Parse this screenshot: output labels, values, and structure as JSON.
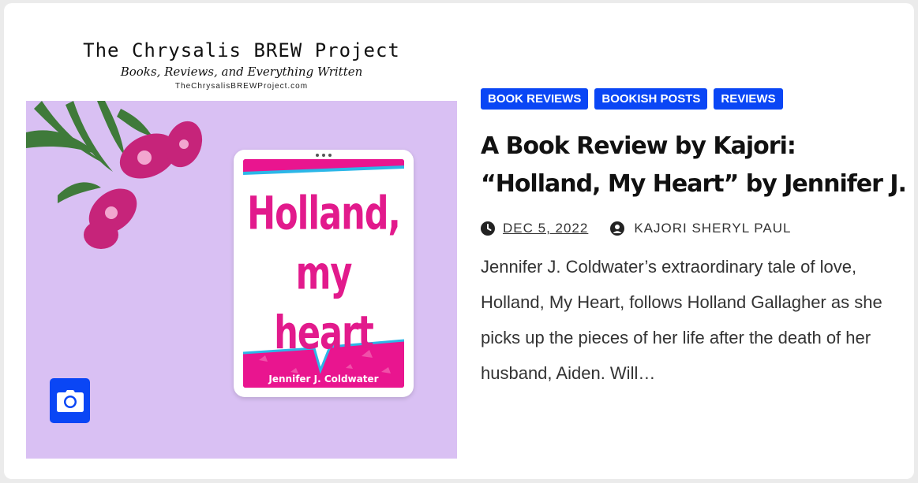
{
  "logo": {
    "title": "The Chrysalis BREW Project",
    "tagline": "Books, Reviews, and Everything Written",
    "url": "TheChrysalisBREWProject.com"
  },
  "cover": {
    "title_line1": "Holland,",
    "title_line2": "my",
    "title_line3": "heart",
    "author": "Jennifer J. Coldwater"
  },
  "categories": [
    "BOOK REVIEWS",
    "BOOKISH POSTS",
    "REVIEWS"
  ],
  "post": {
    "title": "A Book Review by Kajori: “Holland, My Heart” by Jennifer J.",
    "date": "DEC 5, 2022",
    "author": "KAJORI SHERYL PAUL",
    "excerpt": "Jennifer J. Coldwater’s extraordinary tale of love, Holland, My Heart, follows Holland Gallagher as she picks up the pieces of her life after the death of her husband, Aiden. Will…"
  },
  "icons": {
    "date": "clock-icon",
    "author": "user-icon",
    "media": "camera-icon"
  },
  "colors": {
    "accent": "#0a46f5",
    "photo_bg": "#d9c0f3",
    "cover_pink": "#e9158f",
    "text": "#333333"
  }
}
